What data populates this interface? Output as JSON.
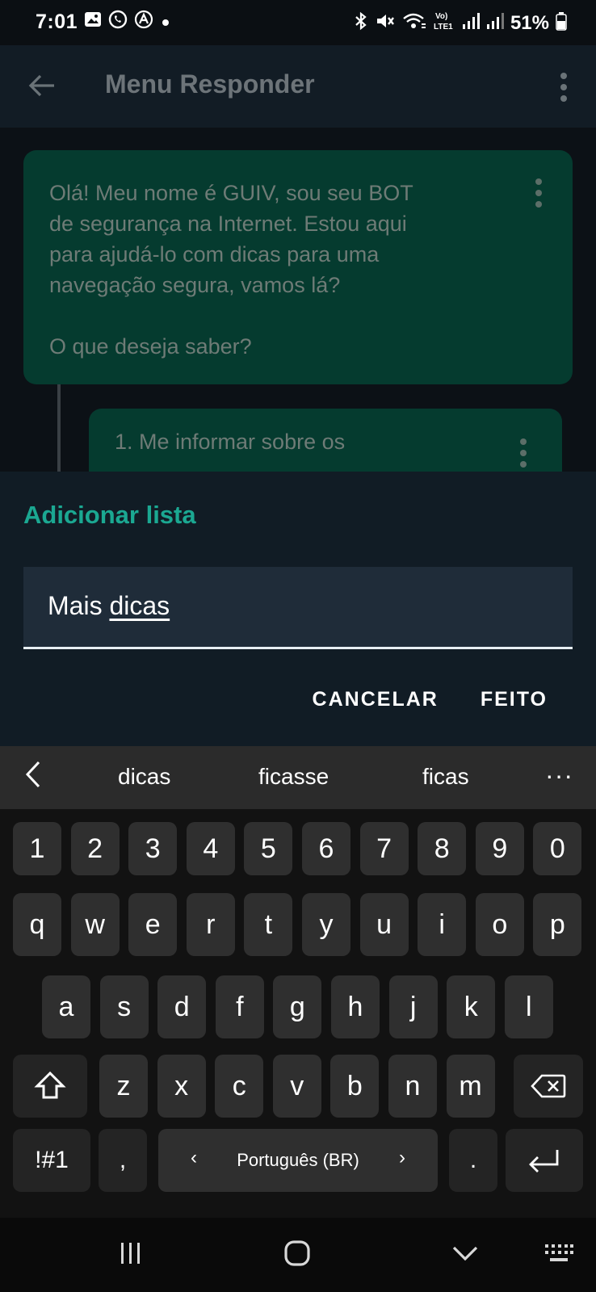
{
  "status_bar": {
    "time": "7:01",
    "left_icons": [
      "gallery-icon",
      "whatsapp-icon",
      "a-circle-icon",
      "dot-icon"
    ],
    "right_icons": [
      "bluetooth-icon",
      "mute-icon",
      "wifi-icon",
      "volte-icon",
      "signal-icon",
      "signal-icon-2"
    ],
    "battery": "51%"
  },
  "app_bar": {
    "title": "Menu Responder"
  },
  "chat": {
    "message_1": "Olá! Meu nome é GUIV, sou seu BOT\nde segurança na Internet. Estou aqui\npara ajudá-lo com dicas para uma\nnavegação segura, vamos lá?\n\nO que deseja saber?",
    "message_2": "1. Me informar sobre os"
  },
  "dialog": {
    "title": "Adicionar lista",
    "input_value_prefix": "Mais ",
    "input_value_underlined": "dicas",
    "cancel_label": "CANCELAR",
    "done_label": "FEITO"
  },
  "suggestions": {
    "words": [
      "dicas",
      "ficasse",
      "ficas"
    ],
    "more": "···"
  },
  "keyboard": {
    "row_numbers": [
      "1",
      "2",
      "3",
      "4",
      "5",
      "6",
      "7",
      "8",
      "9",
      "0"
    ],
    "row_1": [
      "q",
      "w",
      "e",
      "r",
      "t",
      "y",
      "u",
      "i",
      "o",
      "p"
    ],
    "row_2": [
      "a",
      "s",
      "d",
      "f",
      "g",
      "h",
      "j",
      "k",
      "l"
    ],
    "row_3": [
      "z",
      "x",
      "c",
      "v",
      "b",
      "n",
      "m"
    ],
    "symbols_label": "!#1",
    "comma": ",",
    "space_label": "Português (BR)",
    "period": "."
  },
  "colors": {
    "accent": "#1ba892",
    "bubble": "#053b2f",
    "dialog_bg": "#111c25",
    "input_bg": "#1f2c39"
  }
}
